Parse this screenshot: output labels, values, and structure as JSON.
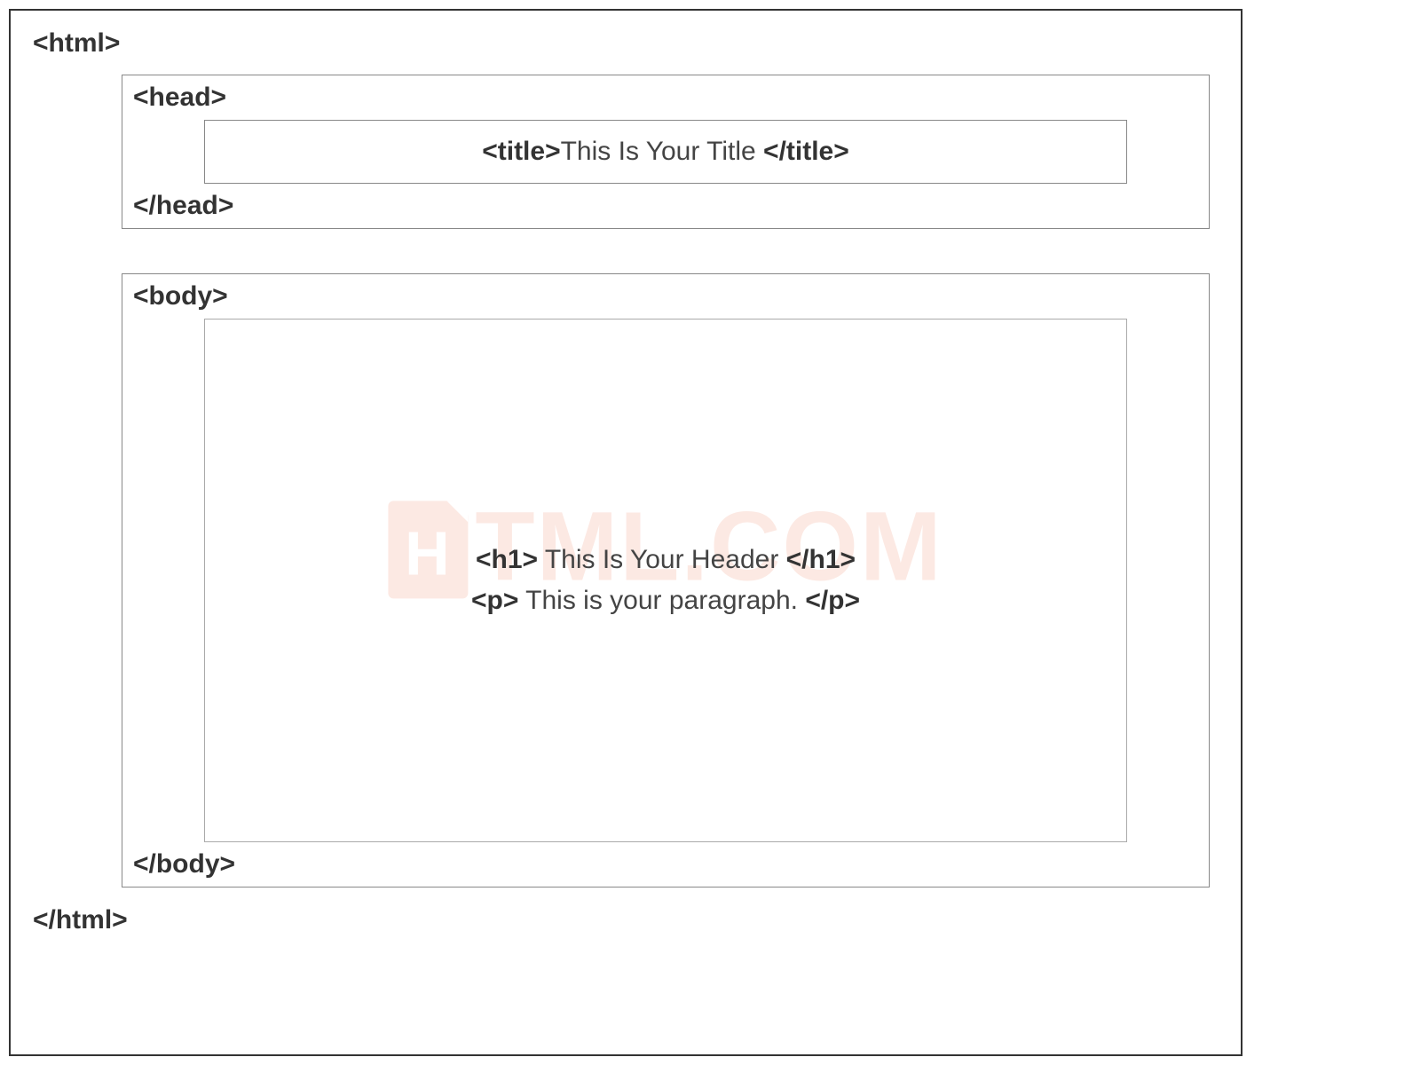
{
  "tags": {
    "html_open": "<html>",
    "html_close": "</html>",
    "head_open": "<head>",
    "head_close": "</head>",
    "title_open": "<title>",
    "title_close": "</title>",
    "body_open": "<body>",
    "body_close": "</body>",
    "h1_open": "<h1>",
    "h1_close": "</h1>",
    "p_open": "<p>",
    "p_close": "</p>"
  },
  "content": {
    "title_text": "This Is Your Title ",
    "header_text": " This Is Your Header ",
    "paragraph_text": " This is your paragraph. "
  },
  "watermark": {
    "text": "TML.COM"
  }
}
